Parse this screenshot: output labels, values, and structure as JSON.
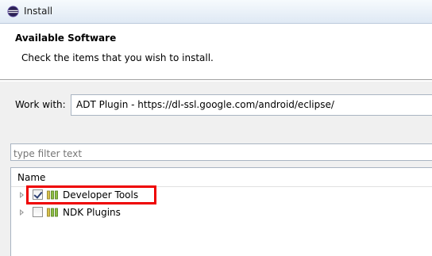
{
  "window": {
    "title": "Install",
    "icon": "eclipse-icon"
  },
  "header": {
    "title": "Available Software",
    "subtitle": "Check the items that you wish to install."
  },
  "work_with": {
    "label": "Work with:",
    "value": "ADT Plugin - https://dl-ssl.google.com/android/eclipse/"
  },
  "filter": {
    "placeholder": "type filter text",
    "value": ""
  },
  "tree": {
    "column_header": "Name",
    "items": [
      {
        "label": "Developer Tools",
        "checked": true,
        "icon": "feature-group-icon",
        "highlighted": true
      },
      {
        "label": "NDK Plugins",
        "checked": false,
        "icon": "feature-group-icon",
        "highlighted": false
      }
    ]
  },
  "colors": {
    "highlight_border": "#ee0000",
    "titlebar": "#dfe9f4",
    "panel_bg": "#f0f0f0"
  }
}
